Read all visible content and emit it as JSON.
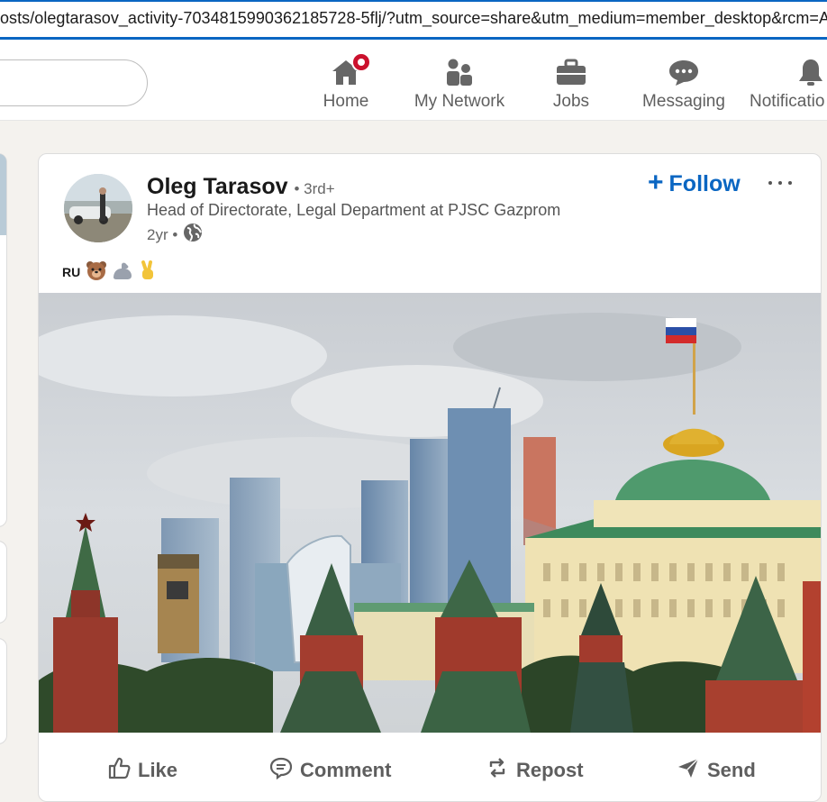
{
  "browser": {
    "url": "osts/olegtarasov_activity-7034815990362185728-5flj/?utm_source=share&utm_medium=member_desktop&rcm=ACoA"
  },
  "nav": {
    "items": [
      {
        "label": "Home",
        "icon": "home-icon"
      },
      {
        "label": "My Network",
        "icon": "people-icon"
      },
      {
        "label": "Jobs",
        "icon": "briefcase-icon"
      },
      {
        "label": "Messaging",
        "icon": "chat-icon"
      },
      {
        "label": "Notificatio",
        "icon": "bell-icon"
      }
    ]
  },
  "post": {
    "author": {
      "name": "Oleg Tarasov",
      "degree": "• 3rd+",
      "headline": "Head of Directorate, Legal Department at PJSC Gazprom",
      "time": "2yr •"
    },
    "follow_label": "Follow",
    "commentary": {
      "code": "RU",
      "emojis": [
        "bear-emoji",
        "flexed-biceps-emoji",
        "victory-hand-emoji"
      ]
    },
    "image": {
      "subject": "Moscow Kremlin towers and Grand Kremlin Palace with Moscow City skyscrapers and Russian flag"
    },
    "actions": [
      {
        "label": "Like",
        "icon": "thumbs-up-icon"
      },
      {
        "label": "Comment",
        "icon": "comment-icon"
      },
      {
        "label": "Repost",
        "icon": "repost-icon"
      },
      {
        "label": "Send",
        "icon": "send-icon"
      }
    ]
  },
  "colors": {
    "accent": "#0a66c2",
    "badge": "#cb112d",
    "background": "#f4f2ee",
    "nav_icon": "#666666"
  }
}
